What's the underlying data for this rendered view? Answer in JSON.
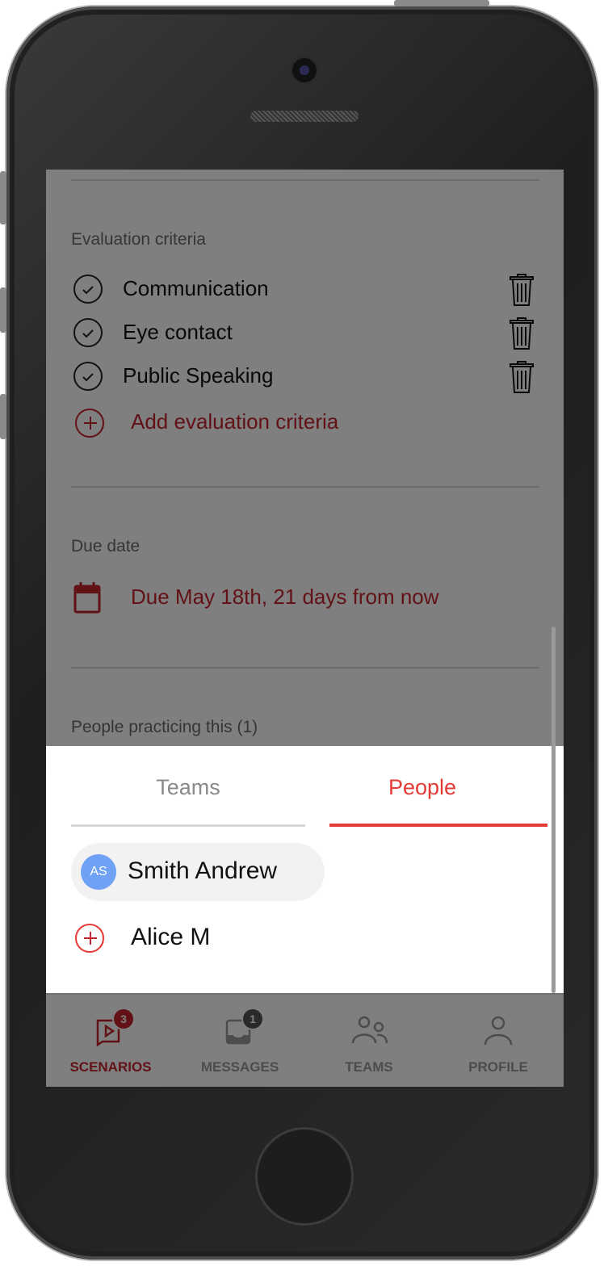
{
  "evaluation": {
    "section_label": "Evaluation criteria",
    "criteria": [
      {
        "label": "Communication"
      },
      {
        "label": "Eye contact"
      },
      {
        "label": "Public Speaking"
      }
    ],
    "add_label": "Add evaluation criteria"
  },
  "due_date": {
    "section_label": "Due date",
    "value": "Due May 18th, 21 days from now"
  },
  "people_practicing": {
    "section_label": "People practicing this (1)"
  },
  "sheet": {
    "tabs": [
      {
        "label": "Teams",
        "active": false
      },
      {
        "label": "People",
        "active": true
      }
    ],
    "selected_person": {
      "initials": "AS",
      "name": "Smith Andrew"
    },
    "available_people": [
      {
        "name": "Alice M"
      }
    ]
  },
  "nav": {
    "items": [
      {
        "label": "SCENARIOS",
        "icon": "scenarios-icon",
        "badge": "3",
        "active": true
      },
      {
        "label": "MESSAGES",
        "icon": "messages-icon",
        "badge": "1",
        "active": false
      },
      {
        "label": "TEAMS",
        "icon": "teams-icon",
        "active": false
      },
      {
        "label": "PROFILE",
        "icon": "profile-icon",
        "active": false
      }
    ]
  },
  "colors": {
    "accent": "#c4242e",
    "tab_active": "#e53935",
    "avatar": "#6fa2f5",
    "overlay": "rgba(0,0,0,0.5)"
  }
}
